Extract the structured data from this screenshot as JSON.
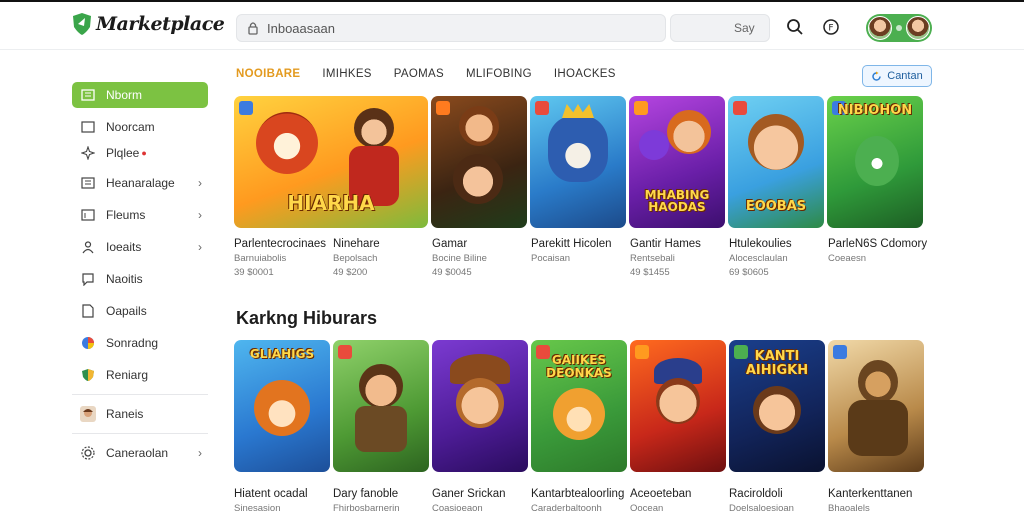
{
  "header": {
    "app_name": "Marketplace",
    "search_text": "Inboaasaan",
    "say_label": "Say"
  },
  "sidebar": {
    "items": [
      {
        "label": "Nborm",
        "icon": "grid-icon",
        "active": true
      },
      {
        "label": "Noorcam",
        "icon": "square-icon"
      },
      {
        "label": "Plqlee",
        "icon": "sparkle-icon"
      },
      {
        "label": "Heanaralage",
        "icon": "grid-icon",
        "chevron": true
      },
      {
        "label": "Fleums",
        "icon": "bars-icon",
        "chevron": true
      },
      {
        "label": "Ioeaits",
        "icon": "person-icon",
        "chevron": true
      },
      {
        "label": "Naoitis",
        "icon": "message-icon"
      },
      {
        "label": "Oapails",
        "icon": "document-icon"
      },
      {
        "label": "Sonradng",
        "icon": "colorful-circle-icon"
      },
      {
        "label": "Reniarg",
        "icon": "shield-icon"
      },
      {
        "label": "Raneis",
        "icon": "avatar-icon"
      },
      {
        "label": "Caneraolan",
        "icon": "settings-icon",
        "chevron": true
      }
    ]
  },
  "tabs": [
    {
      "label": "NOOIBARE",
      "active": true
    },
    {
      "label": "IMIHKES"
    },
    {
      "label": "PAOMAS"
    },
    {
      "label": "MLIFOBING"
    },
    {
      "label": "IHOACKES"
    }
  ],
  "cta_label": "Cantan",
  "row1": [
    {
      "title": "HIARHA",
      "name": "Parlentecrocinaes",
      "sub1": "Barnuiabolis",
      "sub2": "39 $0001"
    },
    {
      "title": "",
      "name": "Ninehare",
      "sub1": "Bepolsach",
      "sub2": "49 $200"
    },
    {
      "title": "",
      "name": "Gamar",
      "sub1": "Bocine Biline",
      "sub2": "49 $0045"
    },
    {
      "title": "",
      "name": "Parekitt Hicolen",
      "sub1": "Pocaisan",
      "sub2": ""
    },
    {
      "title": "MHABING HAODAS",
      "name": "Gantir Hames",
      "sub1": "Rentsebali",
      "sub2": "49 $1455"
    },
    {
      "title": "EOOBAS",
      "name": "Htulekoulies",
      "sub1": "Alocesclaulan",
      "sub2": "69 $0605"
    },
    {
      "title": "NIBIOHON",
      "name": "ParleN6S Cdomory",
      "sub1": "Coeaesn",
      "sub2": ""
    }
  ],
  "section_title": "Karkng Hiburars",
  "row2": [
    {
      "title": "GLIAHIGS",
      "name": "Hiatent ocadal",
      "sub1": "Sinesasion"
    },
    {
      "title": "",
      "name": "Dary fanoble",
      "sub1": "Fhirbosbarnerin"
    },
    {
      "title": "",
      "name": "Ganer Srickan",
      "sub1": "Coasioeaon"
    },
    {
      "title": "GAIIKES DEONKAS",
      "name": "Kantarbtealoorling",
      "sub1": "Caraderbaltoonh"
    },
    {
      "title": "",
      "name": "Aceoeteban",
      "sub1": "Oocean"
    },
    {
      "title": "KANTI AIHIGKH",
      "name": "Raciroldoli",
      "sub1": "Doelsaloesioan"
    },
    {
      "title": "",
      "name": "Kanterkenttanen",
      "sub1": "Bhaoalels"
    }
  ]
}
